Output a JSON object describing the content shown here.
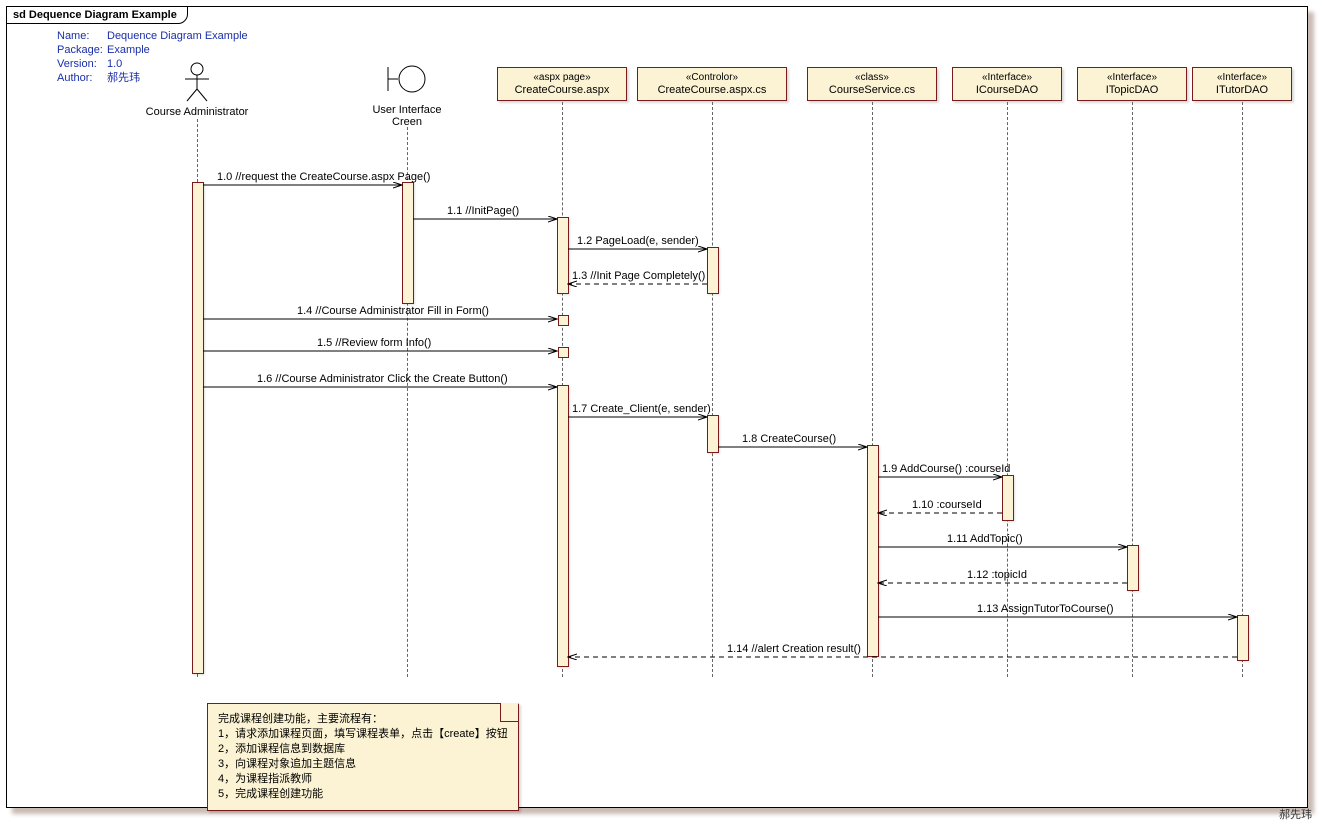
{
  "frame_label": "sd Dequence Diagram Example",
  "meta": {
    "name_k": "Name:",
    "name_v": "Dequence Diagram Example",
    "pkg_k": "Package:",
    "pkg_v": "Example",
    "ver_k": "Version:",
    "ver_v": "1.0",
    "auth_k": "Author:",
    "auth_v": "郝先玮"
  },
  "lifelines": {
    "l1": "Course Administrator",
    "l2_a": "User Interface",
    "l2_b": "Creen",
    "l3_s": "«aspx page»",
    "l3_n": "CreateCourse.aspx",
    "l4_s": "«Controlor»",
    "l4_n": "CreateCourse.aspx.cs",
    "l5_s": "«class»",
    "l5_n": "CourseService.cs",
    "l6_s": "«Interface»",
    "l6_n": "ICourseDAO",
    "l7_s": "«Interface»",
    "l7_n": "ITopicDAO",
    "l8_s": "«Interface»",
    "l8_n": "ITutorDAO"
  },
  "messages": {
    "m1_0": "1.0 //request the CreateCourse.aspx Page()",
    "m1_1": "1.1 //InitPage()",
    "m1_2": "1.2 PageLoad(e, sender)",
    "m1_3": "1.3 //Init Page Completely()",
    "m1_4": "1.4 //Course Administrator Fill in  Form()",
    "m1_5": "1.5 //Review  form Info()",
    "m1_6": "1.6 //Course Administrator Click the Create Button()",
    "m1_7": "1.7 Create_Client(e, sender)",
    "m1_8": "1.8 CreateCourse()",
    "m1_9": "1.9 AddCourse() :courseId",
    "m1_10": "1.10  :courseId",
    "m1_11": "1.11 AddTopic()",
    "m1_12": "1.12  :topicId",
    "m1_13": "1.13 AssignTutorToCourse()",
    "m1_14": "1.14 //alert Creation result()"
  },
  "note": {
    "title": "完成课程创建功能，主要流程有：",
    "l1": "1，请求添加课程页面，填写课程表单，点击【create】按钮",
    "l2": "2，添加课程信息到数据库",
    "l3": "3，向课程对象追加主题信息",
    "l4": "4，为课程指派教师",
    "l5": "5，完成课程创建功能"
  },
  "signature": "郝先玮"
}
